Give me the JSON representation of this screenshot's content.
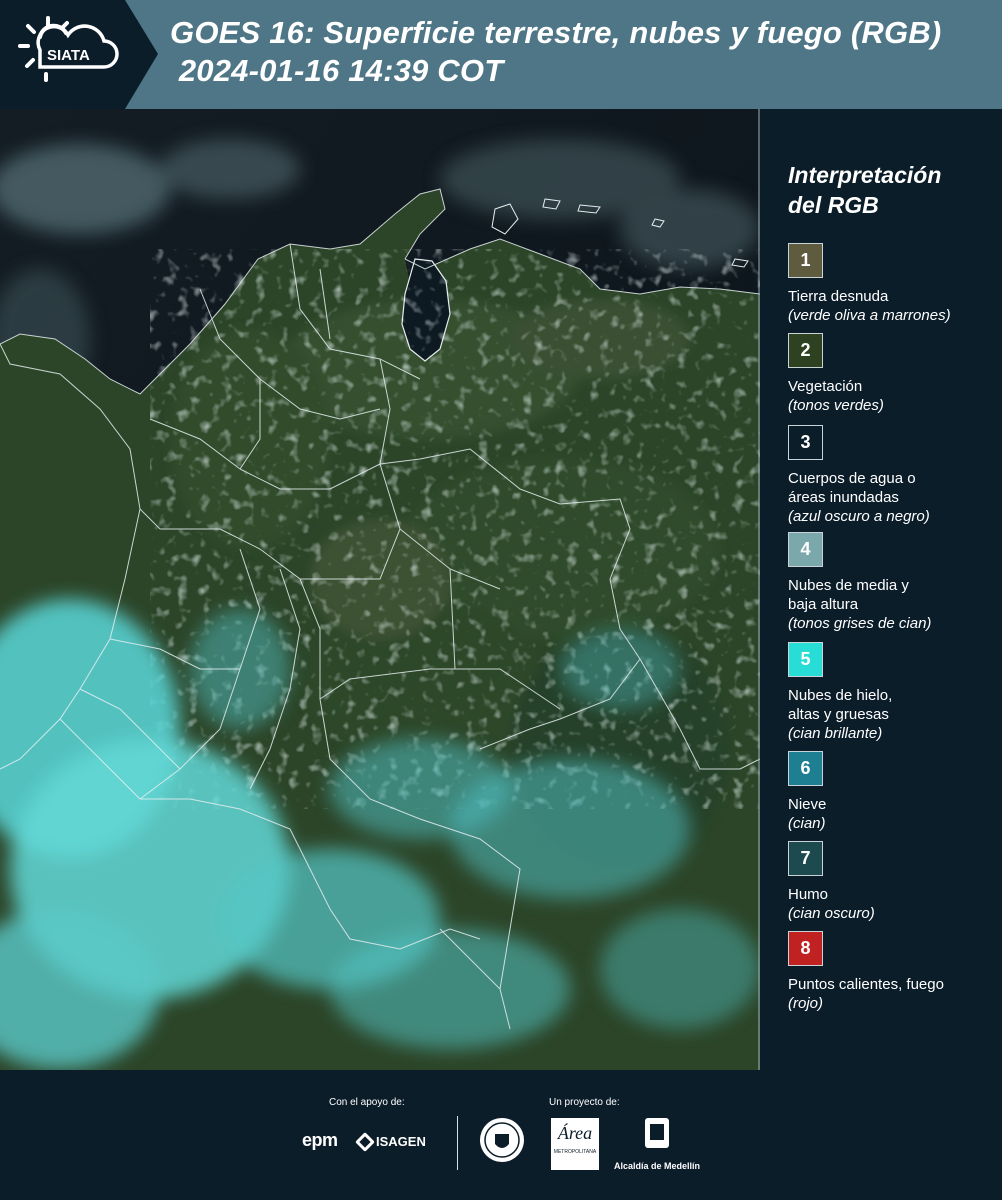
{
  "header": {
    "logo_text": "SIATA",
    "title_line1": "GOES 16: Superficie terrestre, nubes y fuego (RGB)",
    "title_line2": " 2024-01-16 14:39 COT"
  },
  "legend": {
    "title_line1": "Interpretación",
    "title_line2": "del RGB",
    "items": [
      {
        "num": "1",
        "color": "#5e5b3e",
        "lines": [
          "Tierra desnuda"
        ],
        "desc": "(verde oliva a marrones)"
      },
      {
        "num": "2",
        "color": "#2e4120",
        "lines": [
          "Vegetación"
        ],
        "desc": "(tonos verdes)"
      },
      {
        "num": "3",
        "color": "#0c1d2a",
        "lines": [
          "Cuerpos de agua o",
          "áreas inundadas"
        ],
        "desc": "(azul oscuro a negro)"
      },
      {
        "num": "4",
        "color": "#7aa8ab",
        "lines": [
          "Nubes de media y",
          "baja altura"
        ],
        "desc": "(tonos grises de cian)"
      },
      {
        "num": "5",
        "color": "#27ddd6",
        "lines": [
          "Nubes de hielo,",
          "altas y gruesas"
        ],
        "desc": "(cian brillante)"
      },
      {
        "num": "6",
        "color": "#1e7f93",
        "lines": [
          "Nieve"
        ],
        "desc": "(cian)"
      },
      {
        "num": "7",
        "color": "#1d4a4e",
        "lines": [
          "Humo"
        ],
        "desc": "(cian oscuro)"
      },
      {
        "num": "8",
        "color": "#c02121",
        "lines": [
          "Puntos calientes, fuego"
        ],
        "desc": "(rojo)"
      }
    ]
  },
  "footer": {
    "support_caption": "Con el apoyo de:",
    "project_caption": "Un proyecto de:",
    "epm_logo": "epm",
    "isagen_logo": "ISAGEN",
    "area_logo": "Área",
    "area_sub": "METROPOLITANA",
    "alcaldia_logo": "Alcaldía de Medellín"
  },
  "colors": {
    "header_bg": "#4e7686",
    "page_bg": "#0c1d2a",
    "vegetation": "#2e4a2a",
    "cloud_cyan": "#5fd6d4",
    "sea": "#0b141a"
  },
  "icons": [
    "sun-cloud-logo-icon",
    "epm-logo",
    "isagen-logo",
    "gobernacion-seal-icon",
    "area-metropolitana-logo",
    "alcaldia-seal-icon"
  ]
}
